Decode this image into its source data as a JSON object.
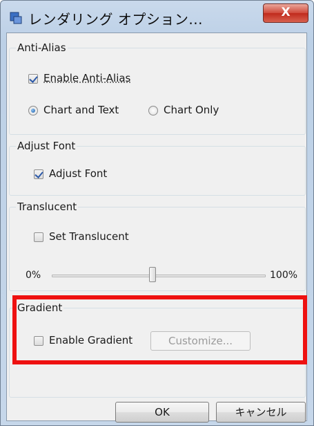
{
  "window": {
    "title": "レンダリング オプション...",
    "close_label": "X",
    "colors": {
      "titlebar": "#c6d7ea",
      "close": "#c9372a",
      "highlight": "#ee1111"
    }
  },
  "anti_alias": {
    "title": "Anti-Alias",
    "enable_label": "Enable Anti-Alias",
    "enable_checked": true,
    "radio_chart_text": "Chart and Text",
    "radio_chart_only": "Chart Only",
    "selected_radio": "Chart and Text"
  },
  "adjust_font": {
    "title": "Adjust Font",
    "checkbox_label": "Adjust Font",
    "checked": true
  },
  "translucent": {
    "title": "Translucent",
    "checkbox_label": "Set Translucent",
    "checked": false,
    "slider_min_label": "0%",
    "slider_max_label": "100%",
    "slider_value_percent": 50
  },
  "gradient": {
    "title": "Gradient",
    "checkbox_label": "Enable Gradient",
    "checked": false,
    "customize_label": "Customize..."
  },
  "footer": {
    "ok_label": "OK",
    "cancel_label": "キャンセル"
  }
}
